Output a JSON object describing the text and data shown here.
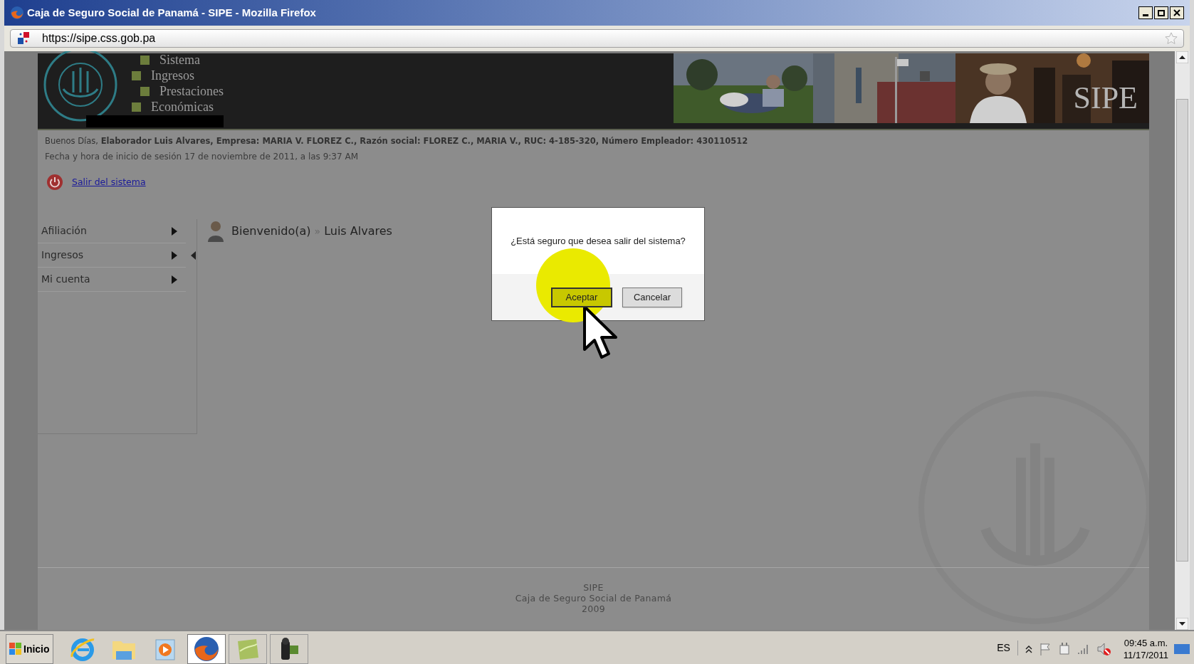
{
  "window": {
    "title": "Caja de Seguro Social de Panamá - SIPE - Mozilla Firefox"
  },
  "address_bar": {
    "url": "https://sipe.css.gob.pa"
  },
  "banner": {
    "menu": [
      "Sistema",
      "Ingresos",
      "Prestaciones",
      "Económicas"
    ],
    "brand": "SIPE"
  },
  "session": {
    "greeting": "Buenos Días, **Elaborador Luis Alvares, Empresa: MARIA V. FLOREZ C., Razón social: FLOREZ C., MARIA V., RUC: 4-185-320, Número Empleador: 430110512**",
    "login_time": "Fecha y hora de inicio de sesión 17 de noviembre de 2011, a las 9:37 AM",
    "logout_link": "Salir del sistema"
  },
  "sidebar": {
    "items": [
      {
        "label": "Afiliación",
        "collapse_handle": false
      },
      {
        "label": "Ingresos",
        "collapse_handle": true
      },
      {
        "label": "Mi cuenta",
        "collapse_handle": false
      }
    ]
  },
  "welcome": {
    "label": "Bienvenido(a)",
    "separator": "»",
    "user": "Luis Alvares"
  },
  "dialog": {
    "message": "¿Está seguro que desea salir del sistema?",
    "buttons": [
      {
        "label": "Aceptar",
        "highlighted": true
      },
      {
        "label": "Cancelar",
        "highlighted": false
      }
    ]
  },
  "footer": [
    "SIPE",
    "Caja de Seguro Social de Panamá",
    "2009"
  ],
  "taskbar": {
    "start": "Inicio",
    "apps": [
      {
        "kind": "ie",
        "selected": false
      },
      {
        "kind": "folder",
        "selected": false
      },
      {
        "kind": "media",
        "selected": false
      },
      {
        "kind": "firefox",
        "selected": true
      },
      {
        "kind": "notes",
        "selected": false
      },
      {
        "kind": "camera",
        "selected": false
      }
    ],
    "language": "ES",
    "time": "09:45 a.m.",
    "date": "11/17/2011"
  }
}
